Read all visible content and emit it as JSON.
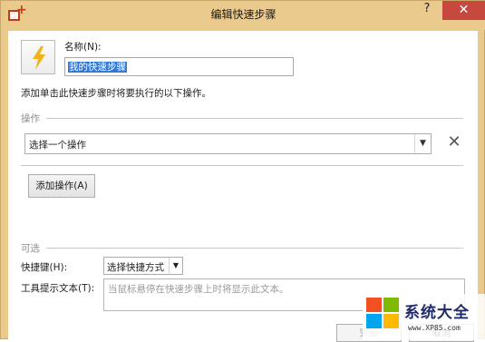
{
  "window": {
    "title": "编辑快速步骤",
    "help": "?",
    "close": "✕"
  },
  "form": {
    "name_label": "名称(N):",
    "name_value": "我的快速步骤",
    "description": "添加单击此快速步骤时将要执行的以下操作。",
    "actions_header": "操作",
    "action_select": "选择一个操作",
    "add_action": "添加操作(A)",
    "optional_header": "可选",
    "shortcut_label": "快捷键(H):",
    "shortcut_value": "选择快捷方式",
    "tooltip_label": "工具提示文本(T):",
    "tooltip_placeholder": "当鼠标悬停在快速步骤上时将显示此文本。"
  },
  "buttons": {
    "ok": "完成",
    "cancel": "取消"
  },
  "watermark": {
    "brand": "系统大全",
    "url": "www.XP85.com"
  },
  "icons": {
    "app": "quick-step-add-icon",
    "step": "lightning-icon",
    "remove": "remove-x-icon"
  },
  "colors": {
    "titlebar": "#e9c98c",
    "close_button": "#c7483e",
    "selection": "#3178d6",
    "lightning": "#f0b41a"
  }
}
